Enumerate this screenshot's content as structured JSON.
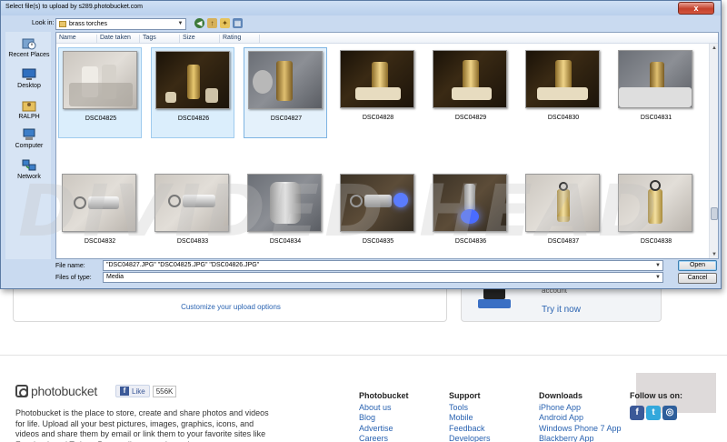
{
  "dialog": {
    "title": "Select file(s) to upload by s289.photobucket.com",
    "close_label": "x",
    "look_in_label": "Look in:",
    "look_in_value": "brass torches",
    "places": [
      {
        "label": "Recent Places",
        "icon": "recent-places-icon"
      },
      {
        "label": "Desktop",
        "icon": "desktop-icon"
      },
      {
        "label": "RALPH",
        "icon": "user-folder-icon"
      },
      {
        "label": "Computer",
        "icon": "computer-icon"
      },
      {
        "label": "Network",
        "icon": "network-icon"
      }
    ],
    "columns": [
      "Name",
      "Date taken",
      "Tags",
      "Size",
      "Rating"
    ],
    "files": [
      {
        "name": "DSC04825",
        "selected": true
      },
      {
        "name": "DSC04826",
        "selected": true
      },
      {
        "name": "DSC04827",
        "selected": true
      },
      {
        "name": "DSC04828",
        "selected": false
      },
      {
        "name": "DSC04829",
        "selected": false
      },
      {
        "name": "DSC04830",
        "selected": false
      },
      {
        "name": "DSC04831",
        "selected": false
      },
      {
        "name": "DSC04832",
        "selected": false
      },
      {
        "name": "DSC04833",
        "selected": false
      },
      {
        "name": "DSC04834",
        "selected": false
      },
      {
        "name": "DSC04835",
        "selected": false
      },
      {
        "name": "DSC04836",
        "selected": false
      },
      {
        "name": "DSC04837",
        "selected": false
      },
      {
        "name": "DSC04838",
        "selected": false
      }
    ],
    "file_name_label": "File name:",
    "file_name_value": "\"DSC04827.JPG\" \"DSC04825.JPG\" \"DSC04826.JPG\"",
    "file_type_label": "Files of type:",
    "file_type_value": "Media",
    "open_label": "Open",
    "cancel_label": "Cancel"
  },
  "watermark": "DIVIDED HEAD",
  "page": {
    "customize_link": "Customize your upload options",
    "account_text": "account",
    "try_it": "Try it now",
    "logo_text": "photobucket",
    "like_label": "Like",
    "like_count": "556K",
    "about": "Photobucket is the place to store, create and share photos and videos for life. Upload all your best pictures, images, graphics, icons, and videos and share them by email or link them to your favorite sites like Facebook and Twitter. Personalize your photos by",
    "col_photobucket": {
      "heading": "Photobucket",
      "links": [
        "About us",
        "Blog",
        "Advertise",
        "Careers"
      ]
    },
    "col_support": {
      "heading": "Support",
      "links": [
        "Tools",
        "Mobile",
        "Feedback",
        "Developers"
      ]
    },
    "col_downloads": {
      "heading": "Downloads",
      "links": [
        "iPhone App",
        "Android App",
        "Windows Phone 7 App",
        "Blackberry App"
      ]
    },
    "follow_label": "Follow us on:",
    "social": [
      "facebook-icon",
      "twitter-icon",
      "myspace-icon"
    ]
  },
  "colors": {
    "dialog_bg": "#c9daf0",
    "selection": "#dbeefc",
    "link": "#2a63b1",
    "close_red": "#c4412c"
  }
}
